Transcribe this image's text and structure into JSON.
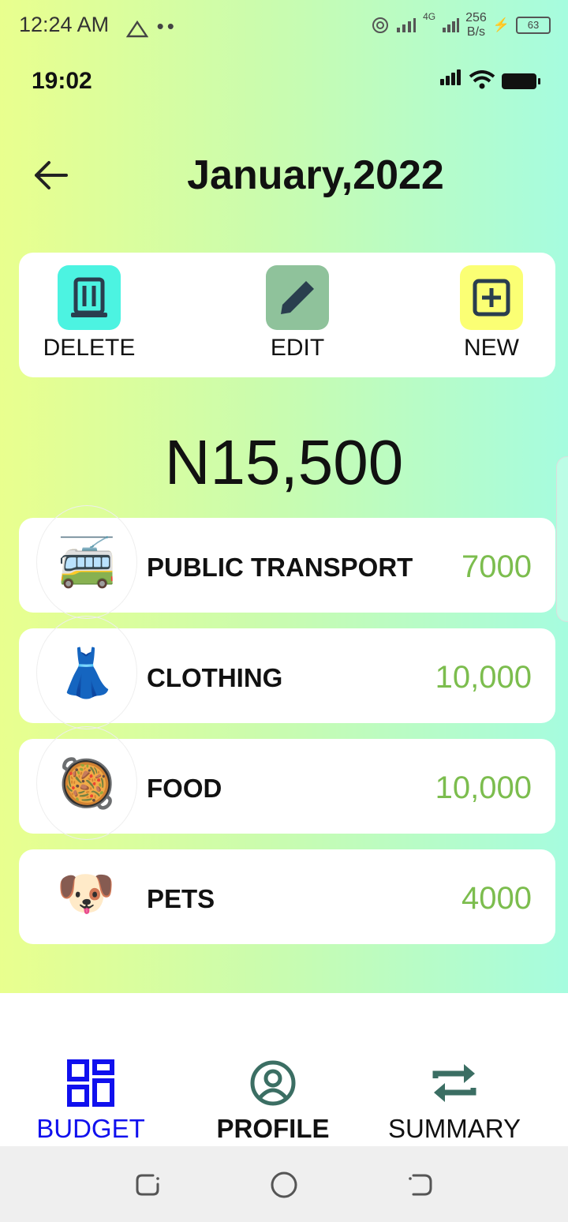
{
  "system": {
    "time": "12:24 AM",
    "net_top": "256",
    "net_bottom": "B/s",
    "network_gen": "4G",
    "battery": "63"
  },
  "app_status": {
    "time": "19:02"
  },
  "header": {
    "title": "January,2022"
  },
  "actions": [
    {
      "label": "DELETE",
      "icon": "trash-icon",
      "color": "#4cf3e1"
    },
    {
      "label": "EDIT",
      "icon": "pencil-icon",
      "color": "#8fc29b"
    },
    {
      "label": "NEW",
      "icon": "plus-square-icon",
      "color": "#fbff74"
    }
  ],
  "total": "N15,500",
  "items": [
    {
      "name": "PUBLIC TRANSPORT",
      "value": "7000",
      "emoji": "🚎",
      "icon": "trolleybus-icon"
    },
    {
      "name": "CLOTHING",
      "value": "10,000",
      "emoji": "👗",
      "icon": "dress-icon"
    },
    {
      "name": "FOOD",
      "value": "10,000",
      "emoji": "🥘",
      "icon": "paella-icon"
    },
    {
      "name": "PETS",
      "value": "4000",
      "emoji": "🐶",
      "icon": "dog-face-icon"
    }
  ],
  "nav": {
    "tabs": [
      {
        "label": "BUDGET",
        "icon": "grid-icon",
        "active": true
      },
      {
        "label": "PROFILE",
        "icon": "person-circle-icon",
        "active": false
      },
      {
        "label": "SUMMARY",
        "icon": "swap-arrows-icon",
        "active": false
      }
    ]
  },
  "colors": {
    "active": "#1010ee",
    "value": "#7cbd4e",
    "icon": "#3b6e63"
  }
}
